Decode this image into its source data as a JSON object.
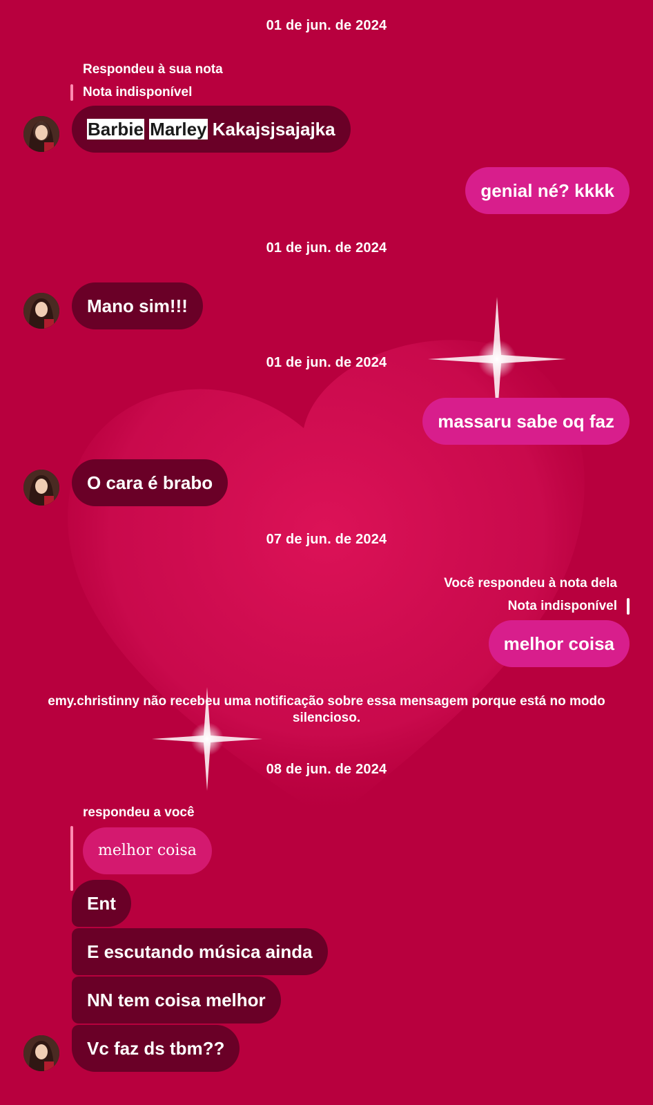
{
  "contact": {
    "username": "emy.christinny",
    "avatar_icon": "profile-photo-icon"
  },
  "theme": {
    "background": "#b8003e",
    "incoming_bubble": "#6a0027",
    "outgoing_bubble": "#d81e8c"
  },
  "thread": {
    "date_1": "01 de jun. de 2024",
    "reply_caption_1": "Respondeu à sua nota",
    "reply_note_1": "Nota indisponível",
    "msg_1_hl_a": "Barbie",
    "msg_1_hl_b": "Marley",
    "msg_1_rest": "Kakajsjsajajka",
    "msg_2": "genial né? kkkk",
    "date_2": "01 de jun. de 2024",
    "msg_3": "Mano sim!!!",
    "date_3": "01 de jun. de 2024",
    "msg_4": "massaru sabe oq faz",
    "msg_5": "O cara é brabo",
    "date_4": "07 de jun. de 2024",
    "reply_caption_2": "Você respondeu à nota dela",
    "reply_note_2": "Nota indisponível",
    "msg_6": "melhor coisa",
    "system_note": "emy.christinny não recebeu uma notificação sobre essa mensagem porque está no modo silencioso.",
    "date_5": "08 de jun. de 2024",
    "reply_caption_3": "respondeu a você",
    "quoted_msg": "melhor coisa",
    "msg_7": "Ent",
    "msg_8": "E escutando música ainda",
    "msg_9": "NN tem coisa melhor",
    "msg_10": "Vc faz ds tbm??"
  }
}
